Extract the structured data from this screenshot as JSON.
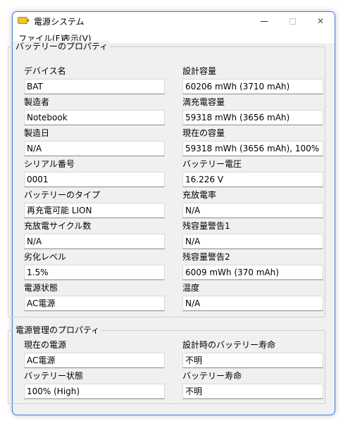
{
  "window": {
    "title": "電源システム"
  },
  "menu": {
    "file": "ファイル(F)",
    "view": "表示(V)"
  },
  "battery": {
    "legend": "バッテリーのプロパティ",
    "device_name": {
      "label": "デバイス名",
      "value": "BAT"
    },
    "design_capacity": {
      "label": "設計容量",
      "value": "60206 mWh (3710 mAh)"
    },
    "manufacturer": {
      "label": "製造者",
      "value": "Notebook"
    },
    "full_charge_capacity": {
      "label": "満充電容量",
      "value": "59318 mWh (3656 mAh)"
    },
    "manufacture_date": {
      "label": "製造日",
      "value": "N/A"
    },
    "current_capacity": {
      "label": "現在の容量",
      "value": "59318 mWh (3656 mAh), 100%"
    },
    "serial_number": {
      "label": "シリアル番号",
      "value": "0001"
    },
    "battery_voltage": {
      "label": "バッテリー電圧",
      "value": "16.226 V"
    },
    "battery_type": {
      "label": "バッテリーのタイプ",
      "value": "再充電可能 LION"
    },
    "charge_rate": {
      "label": "充放電率",
      "value": "N/A"
    },
    "cycle_count": {
      "label": "充放電サイクル数",
      "value": "N/A"
    },
    "warning_level_1": {
      "label": "残容量警告1",
      "value": "N/A"
    },
    "wear_level": {
      "label": "劣化レベル",
      "value": "1.5%"
    },
    "warning_level_2": {
      "label": "残容量警告2",
      "value": "6009 mWh (370 mAh)"
    },
    "power_state": {
      "label": "電源状態",
      "value": "AC電源"
    },
    "temperature": {
      "label": "温度",
      "value": "N/A"
    }
  },
  "power": {
    "legend": "電源管理のプロパティ",
    "current_source": {
      "label": "現在の電源",
      "value": "AC電源"
    },
    "design_life": {
      "label": "設計時のバッテリー寿命",
      "value": "不明"
    },
    "battery_status": {
      "label": "バッテリー状態",
      "value": "100% (High)"
    },
    "battery_life": {
      "label": "バッテリー寿命",
      "value": "不明"
    }
  }
}
